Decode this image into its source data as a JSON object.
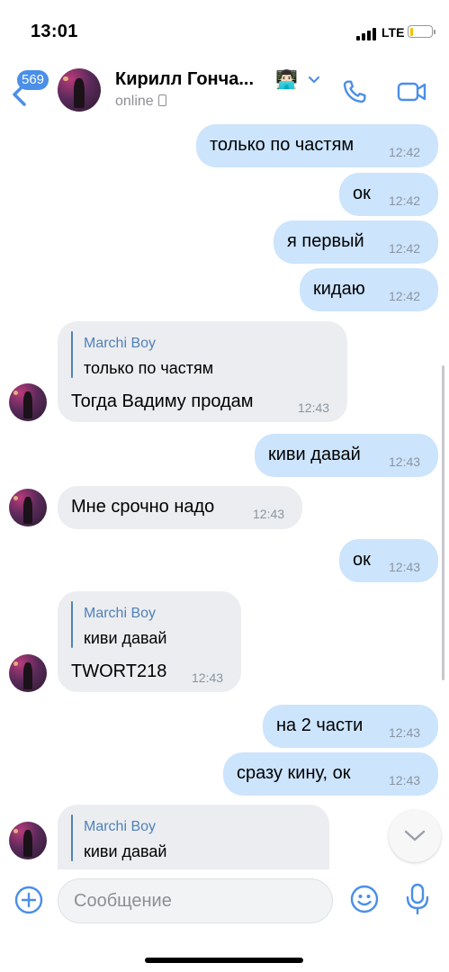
{
  "status_bar": {
    "time": "13:01",
    "network": "LTE",
    "battery_level": 0.15
  },
  "header": {
    "back_count": "569",
    "contact_name": "Кирилл Гонча...",
    "emoji": "👨🏻‍💻",
    "presence": "online"
  },
  "messages": [
    {
      "dir": "out",
      "text": "только по частям",
      "time": "12:42"
    },
    {
      "dir": "out",
      "text": "ок",
      "time": "12:42"
    },
    {
      "dir": "out",
      "text": "я первый",
      "time": "12:42"
    },
    {
      "dir": "out",
      "text": "кидаю",
      "time": "12:42"
    },
    {
      "dir": "in",
      "reply_author": "Marchi Boy",
      "reply_text": "только по частям",
      "text": "Тогда Вадиму продам",
      "time": "12:43"
    },
    {
      "dir": "out",
      "text": "киви давай",
      "time": "12:43"
    },
    {
      "dir": "in",
      "text": "Мне срочно надо",
      "time": "12:43"
    },
    {
      "dir": "out",
      "text": "ок",
      "time": "12:43"
    },
    {
      "dir": "in",
      "reply_author": "Marchi Boy",
      "reply_text": "киви давай",
      "text": "TWORT218",
      "time": "12:43"
    },
    {
      "dir": "out",
      "text": "на 2 части",
      "time": "12:43"
    },
    {
      "dir": "out",
      "text": "сразу кину, ок",
      "time": "12:43"
    },
    {
      "dir": "in",
      "reply_author": "Marchi Boy",
      "reply_text": "киви давай",
      "text": "",
      "time": ""
    }
  ],
  "composer": {
    "placeholder": "Сообщение"
  },
  "colors": {
    "accent": "#4a8fe8",
    "outgoing_bubble": "#cce4fc",
    "incoming_bubble": "#ebedf0",
    "reply_accent": "#5181b8"
  }
}
